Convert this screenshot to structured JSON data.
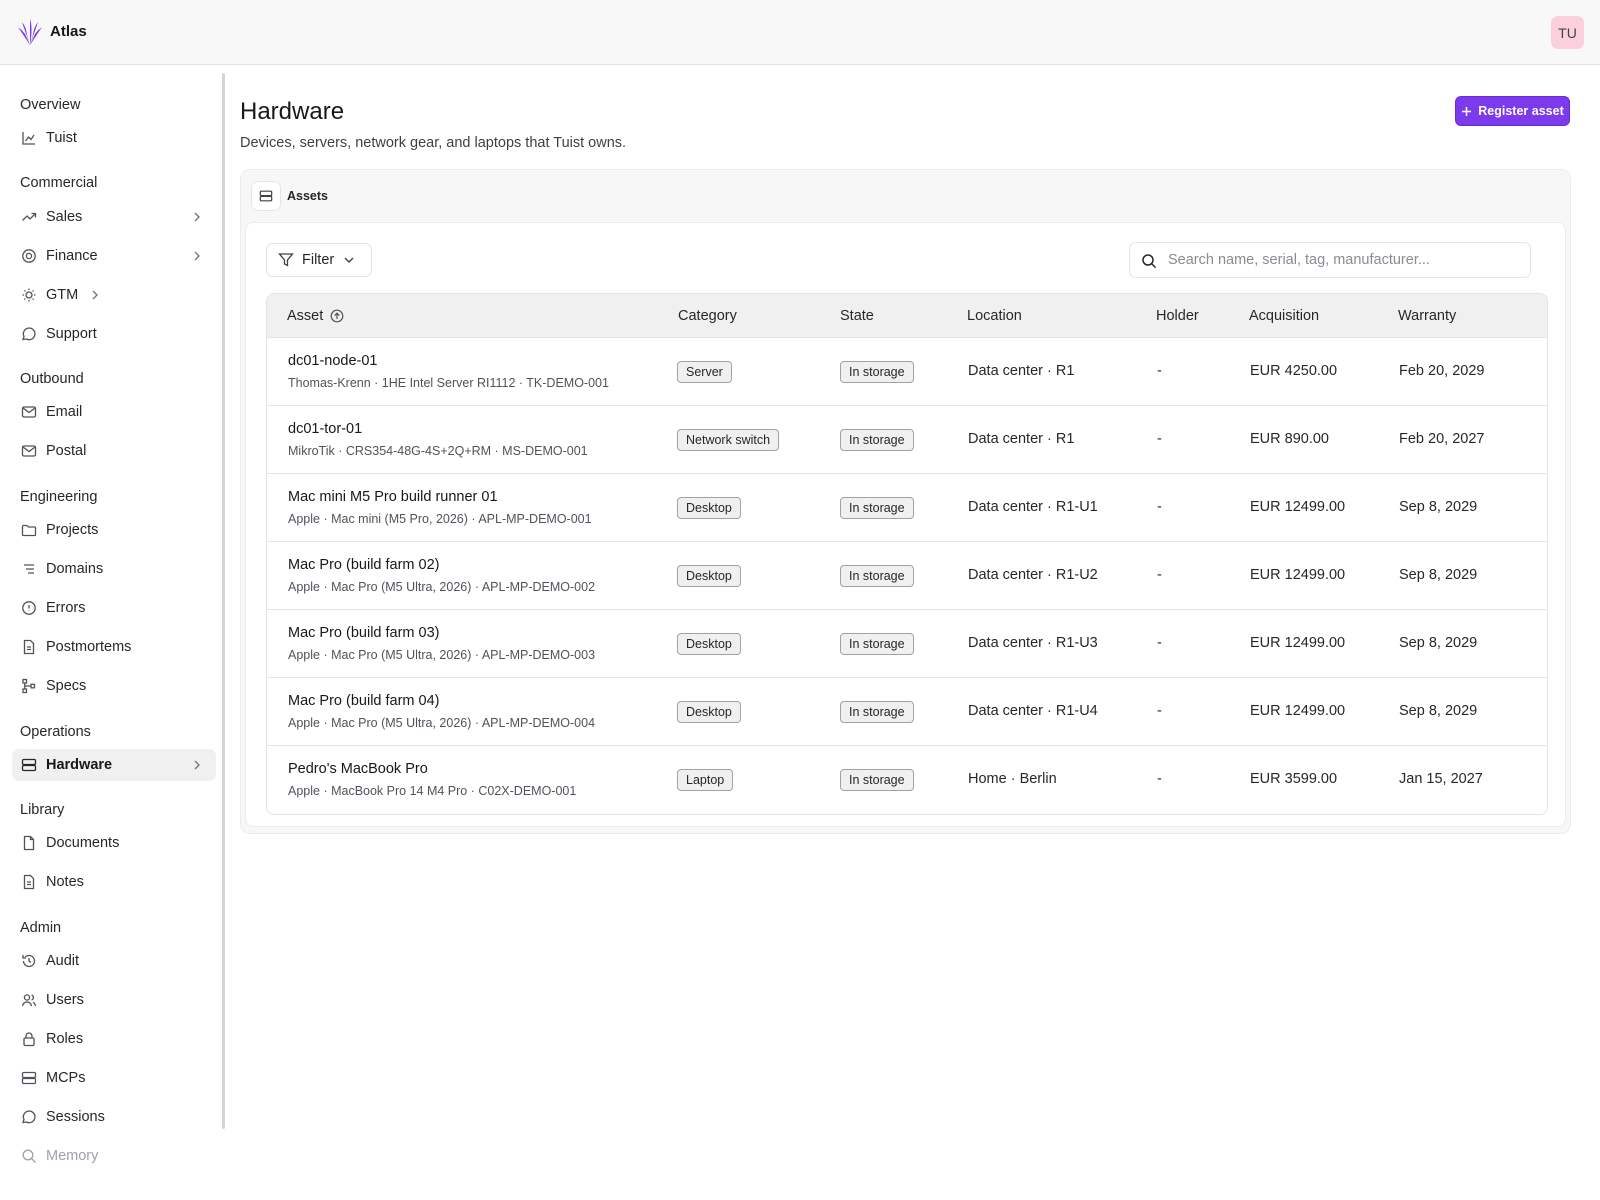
{
  "app": {
    "title": "Atlas",
    "avatar_initials": "TU",
    "accent_color": "#7c3aed"
  },
  "sidebar": {
    "sections": [
      {
        "title": "Overview",
        "items": [
          {
            "label": "Tuist",
            "icon": "chart-icon"
          }
        ]
      },
      {
        "title": "Commercial",
        "items": [
          {
            "label": "Sales",
            "icon": "trending-up-icon",
            "chevron": true
          },
          {
            "label": "Finance",
            "icon": "coins-icon",
            "chevron": true
          },
          {
            "label": "GTM",
            "icon": "lightbulb-icon",
            "chevron": true
          },
          {
            "label": "Support",
            "icon": "chat-icon"
          }
        ]
      },
      {
        "title": "Outbound",
        "items": [
          {
            "label": "Email",
            "icon": "mail-icon"
          },
          {
            "label": "Postal",
            "icon": "mail-icon"
          }
        ]
      },
      {
        "title": "Engineering",
        "items": [
          {
            "label": "Projects",
            "icon": "folder-icon"
          },
          {
            "label": "Domains",
            "icon": "list-icon"
          },
          {
            "label": "Errors",
            "icon": "alert-circle-icon"
          },
          {
            "label": "Postmortems",
            "icon": "file-text-icon"
          },
          {
            "label": "Specs",
            "icon": "hierarchy-icon"
          }
        ]
      },
      {
        "title": "Operations",
        "items": [
          {
            "label": "Hardware",
            "icon": "server-icon",
            "chevron": true,
            "active": true
          }
        ]
      },
      {
        "title": "Library",
        "items": [
          {
            "label": "Documents",
            "icon": "file-icon"
          },
          {
            "label": "Notes",
            "icon": "file-text-icon"
          }
        ]
      },
      {
        "title": "Admin",
        "items": [
          {
            "label": "Audit",
            "icon": "history-icon"
          },
          {
            "label": "Users",
            "icon": "users-icon"
          },
          {
            "label": "Roles",
            "icon": "lock-icon"
          },
          {
            "label": "MCPs",
            "icon": "server-icon"
          },
          {
            "label": "Sessions",
            "icon": "chat-icon"
          },
          {
            "label": "Memory",
            "icon": "search-icon",
            "disabled": true
          }
        ]
      }
    ]
  },
  "page": {
    "title": "Hardware",
    "subtitle": "Devices, servers, network gear, and laptops that Tuist owns.",
    "register_label": "Register asset"
  },
  "panel": {
    "label": "Assets"
  },
  "toolbar": {
    "filter_label": "Filter",
    "search_placeholder": "Search name, serial, tag, manufacturer..."
  },
  "table": {
    "columns": [
      "Asset",
      "Category",
      "State",
      "Location",
      "Holder",
      "Acquisition",
      "Warranty"
    ],
    "rows": [
      {
        "name": "dc01-node-01",
        "detail": "Thomas-Krenn · 1HE Intel Server RI1112 · TK-DEMO-001",
        "category": "Server",
        "state": "In storage",
        "location": "Data center · R1",
        "holder": "-",
        "acquisition": "EUR 4250.00",
        "warranty": "Feb 20, 2029"
      },
      {
        "name": "dc01-tor-01",
        "detail": "MikroTik · CRS354-48G-4S+2Q+RM · MS-DEMO-001",
        "category": "Network switch",
        "state": "In storage",
        "location": "Data center · R1",
        "holder": "-",
        "acquisition": "EUR 890.00",
        "warranty": "Feb 20, 2027"
      },
      {
        "name": "Mac mini M5 Pro build runner 01",
        "detail": "Apple · Mac mini (M5 Pro, 2026) · APL-MP-DEMO-001",
        "category": "Desktop",
        "state": "In storage",
        "location": "Data center · R1-U1",
        "holder": "-",
        "acquisition": "EUR 12499.00",
        "warranty": "Sep 8, 2029"
      },
      {
        "name": "Mac Pro (build farm 02)",
        "detail": "Apple · Mac Pro (M5 Ultra, 2026) · APL-MP-DEMO-002",
        "category": "Desktop",
        "state": "In storage",
        "location": "Data center · R1-U2",
        "holder": "-",
        "acquisition": "EUR 12499.00",
        "warranty": "Sep 8, 2029"
      },
      {
        "name": "Mac Pro (build farm 03)",
        "detail": "Apple · Mac Pro (M5 Ultra, 2026) · APL-MP-DEMO-003",
        "category": "Desktop",
        "state": "In storage",
        "location": "Data center · R1-U3",
        "holder": "-",
        "acquisition": "EUR 12499.00",
        "warranty": "Sep 8, 2029"
      },
      {
        "name": "Mac Pro (build farm 04)",
        "detail": "Apple · Mac Pro (M5 Ultra, 2026) · APL-MP-DEMO-004",
        "category": "Desktop",
        "state": "In storage",
        "location": "Data center · R1-U4",
        "holder": "-",
        "acquisition": "EUR 12499.00",
        "warranty": "Sep 8, 2029"
      },
      {
        "name": "Pedro's MacBook Pro",
        "detail": "Apple · MacBook Pro 14 M4 Pro · C02X-DEMO-001",
        "category": "Laptop",
        "state": "In storage",
        "location": "Home · Berlin",
        "holder": "-",
        "acquisition": "EUR 3599.00",
        "warranty": "Jan 15, 2027"
      }
    ]
  }
}
